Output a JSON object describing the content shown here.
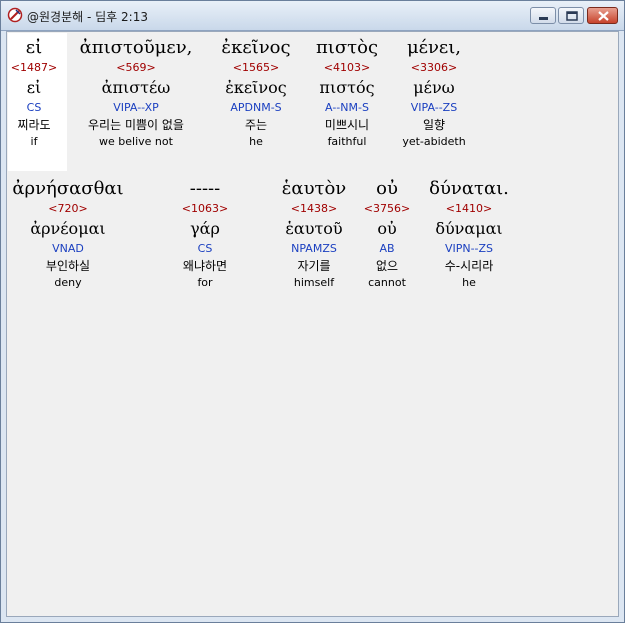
{
  "window": {
    "title": "@원경분해 - 딤후 2:13",
    "icons": {
      "app": "app-icon",
      "minimize": "minimize-icon",
      "maximize": "maximize-icon",
      "close": "close-icon"
    },
    "colors": {
      "strong": "#a00000",
      "parse": "#1a3fc0",
      "close_button": "#c7432c"
    }
  },
  "verse_lines": [
    {
      "words": [
        {
          "greek": "εἰ",
          "strong": "<1487>",
          "lemma": "εἰ",
          "parse": "CS",
          "korean": "찌라도",
          "english": "if"
        },
        {
          "greek": "ἀπιστοῦμεν,",
          "strong": "<569>",
          "lemma": "ἀπιστέω",
          "parse": "VIPA--XP",
          "korean": "우리는 미쁨이 없을",
          "english": "we belive not"
        },
        {
          "greek": "ἐκεῖνος",
          "strong": "<1565>",
          "lemma": "ἐκεῖνος",
          "parse": "APDNM-S",
          "korean": "주는",
          "english": "he"
        },
        {
          "greek": "πιστὸς",
          "strong": "<4103>",
          "lemma": "πιστός",
          "parse": "A--NM-S",
          "korean": "미쁘시니",
          "english": "faithful"
        },
        {
          "greek": "μένει,",
          "strong": "<3306>",
          "lemma": "μένω",
          "parse": "VIPA--ZS",
          "korean": "일향",
          "english": "yet-abideth"
        }
      ]
    },
    {
      "words": [
        {
          "greek": "ἀρνήσασθαι",
          "strong": "<720>",
          "lemma": "ἀρνέομαι",
          "parse": "VNAD",
          "korean": "부인하실",
          "english": "deny"
        },
        {
          "greek": "-----",
          "strong": "<1063>",
          "lemma": "γάρ",
          "parse": "CS",
          "korean": "왜냐하면",
          "english": "for"
        },
        {
          "greek": "ἑαυτὸν",
          "strong": "<1438>",
          "lemma": "ἑαυτοῦ",
          "parse": "NPAMZS",
          "korean": "자기를",
          "english": "himself"
        },
        {
          "greek": "οὐ",
          "strong": "<3756>",
          "lemma": "οὐ",
          "parse": "AB",
          "korean": "없으",
          "english": "cannot"
        },
        {
          "greek": "δύναται.",
          "strong": "<1410>",
          "lemma": "δύναμαι",
          "parse": "VIPN--ZS",
          "korean": "수-시리라",
          "english": "he"
        }
      ]
    }
  ]
}
